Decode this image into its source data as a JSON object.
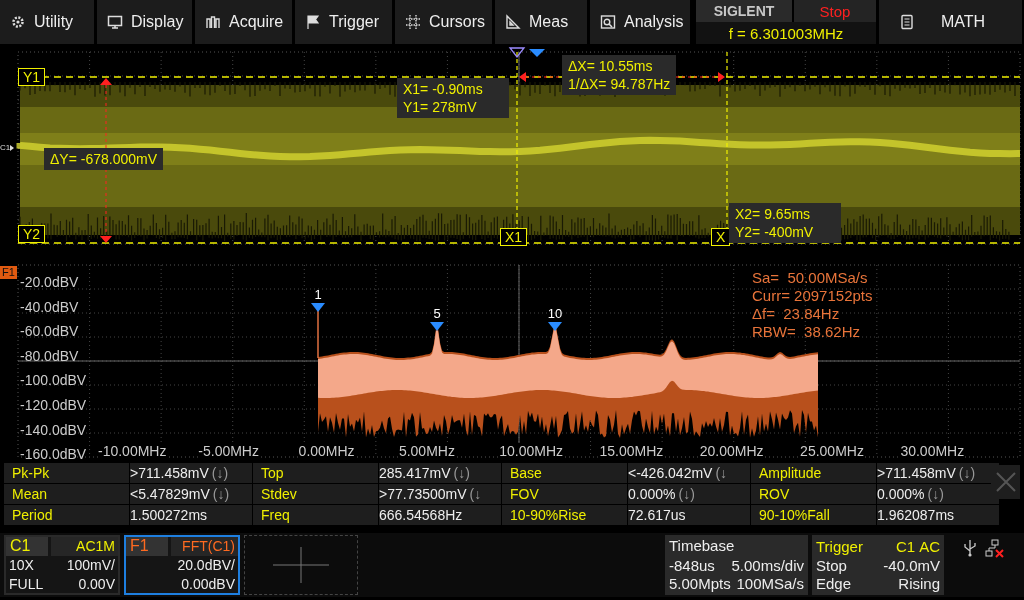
{
  "menu": [
    {
      "label": "Utility"
    },
    {
      "label": "Display"
    },
    {
      "label": "Acquire"
    },
    {
      "label": "Trigger"
    },
    {
      "label": "Cursors"
    },
    {
      "label": "Meas"
    },
    {
      "label": "Analysis"
    }
  ],
  "brand": {
    "name": "SIGLENT",
    "run_state": "Stop",
    "frequency": "f = 6.301003MHz"
  },
  "math_button": "MATH",
  "waveform_panel": {
    "channel_label": "C1",
    "y1_tag": "Y1",
    "y2_tag": "Y2",
    "x1_tag": "X1",
    "x2_tag": "X",
    "delta_y": "ΔY= -678.000mV",
    "x1_readout": [
      "X1= -0.90ms",
      "Y1= 278mV"
    ],
    "delta_x_readout": [
      "ΔX= 10.55ms",
      "1/ΔX= 94.787Hz"
    ],
    "x2_readout": [
      "X2= 9.65ms",
      "Y2= -400mV"
    ]
  },
  "fft_panel": {
    "tag": "F1",
    "y_ticks": [
      "-20.0dBV",
      "-40.0dBV",
      "-60.0dBV",
      "-80.0dBV",
      "-100.0dBV",
      "-120.0dBV",
      "-140.0dBV",
      "-160.0dBV"
    ],
    "x_ticks": [
      "-10.00MHz",
      "-5.00MHz",
      "0.00MHz",
      "5.00MHz",
      "10.00MHz",
      "15.00MHz",
      "20.00MHz",
      "25.00MHz",
      "30.00MHz"
    ],
    "markers": [
      {
        "label": "1"
      },
      {
        "label": "5"
      },
      {
        "label": "10"
      }
    ],
    "info": [
      "Sa=  50.00MSa/s",
      "Curr= 2097152pts",
      "Δf=  23.84Hz",
      "RBW=  38.62Hz"
    ]
  },
  "measurements": [
    [
      {
        "name": "Pk-Pk",
        "value": ">711.458mV",
        "flag": "(↓)"
      },
      {
        "name": "Top",
        "value": "285.417mV",
        "flag": "(↓)"
      },
      {
        "name": "Base",
        "value": "<-426.042mV",
        "flag": "(↓"
      },
      {
        "name": "Amplitude",
        "value": ">711.458mV",
        "flag": "(↓)"
      }
    ],
    [
      {
        "name": "Mean",
        "value": "<5.47829mV",
        "flag": "(↓)"
      },
      {
        "name": "Stdev",
        "value": ">77.73500mV",
        "flag": "(↓"
      },
      {
        "name": "FOV",
        "value": "0.000%",
        "flag": "(↓)"
      },
      {
        "name": "ROV",
        "value": "0.000%",
        "flag": "(↓)"
      }
    ],
    [
      {
        "name": "Period",
        "value": "1.500272ms"
      },
      {
        "name": "Freq",
        "value": "666.54568Hz"
      },
      {
        "name": "10-90%Rise",
        "value": "72.617us"
      },
      {
        "name": "90-10%Fall",
        "value": "1.962087ms"
      }
    ]
  ],
  "channel_box": {
    "name": "C1",
    "coupling": "AC1M",
    "probe": "10X",
    "scale": "100mV/",
    "bandwidth": "FULL",
    "offset": "0.00V",
    "selected": false
  },
  "math_box": {
    "name": "F1",
    "source": "FFT(C1)",
    "scale": "20.0dBV/",
    "offset": "0.00dBV",
    "selected": true
  },
  "timebase": {
    "title": "Timebase",
    "delay": "-848us",
    "scale": "5.00ms/div",
    "memory": "5.00Mpts",
    "sample_rate": "100MSa/s"
  },
  "trigger": {
    "title": "Trigger",
    "source": "C1",
    "coupling": "AC",
    "state": "Stop",
    "trigger_level": "-40.0mV",
    "type": "Edge",
    "slope": "Rising"
  }
}
